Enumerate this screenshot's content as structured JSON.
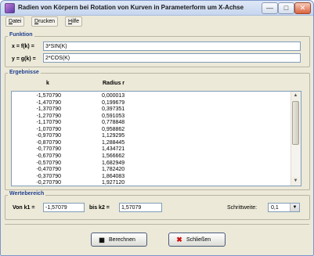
{
  "window": {
    "title": "Radien von Körpern bei Rotation von Kurven in Parameterform um X-Achse"
  },
  "menu": [
    {
      "label": "Datei",
      "underline": "D"
    },
    {
      "label": "Drucken",
      "underline": "D"
    },
    {
      "label": "Hilfe",
      "underline": "H"
    }
  ],
  "funktion": {
    "title": "Funktion",
    "x_label": "x = f(k) =",
    "x_value": "3*SIN(K)",
    "y_label": "y = g(k) =",
    "y_value": "2*COS(K)"
  },
  "ergebnisse": {
    "title": "Ergebnisse",
    "col_k": "k",
    "col_r": "Radius r",
    "rows": [
      {
        "k": "-1,570790",
        "r": "0,000013"
      },
      {
        "k": "-1,470790",
        "r": "0,199679"
      },
      {
        "k": "-1,370790",
        "r": "0,397351"
      },
      {
        "k": "-1,270790",
        "r": "0,591053"
      },
      {
        "k": "-1,170790",
        "r": "0,778848"
      },
      {
        "k": "-1,070790",
        "r": "0,958862"
      },
      {
        "k": "-0,970790",
        "r": "1,129295"
      },
      {
        "k": "-0,870790",
        "r": "1,288445"
      },
      {
        "k": "-0,770790",
        "r": "1,434721"
      },
      {
        "k": "-0,670790",
        "r": "1,566662"
      },
      {
        "k": "-0,570790",
        "r": "1,682949"
      },
      {
        "k": "-0,470790",
        "r": "1,782420"
      },
      {
        "k": "-0,370790",
        "r": "1,864083"
      },
      {
        "k": "-0,270790",
        "r": "1,927120"
      }
    ]
  },
  "wertebereich": {
    "title": "Wertebereich",
    "from_label": "Von k1 =",
    "from_value": "-1,57079",
    "to_label": "bis k2 =",
    "to_value": "1,57079",
    "step_label": "Schrittweite:",
    "step_value": "0,1"
  },
  "buttons": {
    "calculate": "Berechnen",
    "close": "Schließen"
  },
  "colors": {
    "group_title": "#1f3f8f",
    "close_icon": "#cc1111"
  }
}
